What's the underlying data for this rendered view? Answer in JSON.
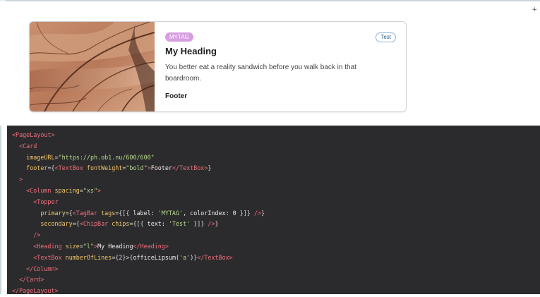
{
  "toolbar": {
    "expand_icon": "plus-icon"
  },
  "card": {
    "image": "photo of curved stone wall",
    "tag_label": "MYTAG",
    "chip_label": "Test",
    "heading": "My Heading",
    "body": "You better eat a reality sandwich before you walk back in that boardroom.",
    "footer": "Footer"
  },
  "colors": {
    "tag_bg": "#d79ee0",
    "chip_border": "#8fb2d6",
    "code_bg": "#2b2b2d",
    "code_tag": "#f06e7a",
    "code_attr": "#f3c667",
    "code_string": "#b9d98a"
  },
  "code": {
    "lines": [
      {
        "indent": "",
        "tokens": [
          {
            "c": "tg",
            "t": "<PageLayout>"
          }
        ]
      },
      {
        "indent": "  ",
        "tokens": [
          {
            "c": "tg",
            "t": "<Card"
          }
        ]
      },
      {
        "indent": "    ",
        "tokens": [
          {
            "c": "at",
            "t": "imageURL"
          },
          {
            "c": "pn",
            "t": "="
          },
          {
            "c": "st",
            "t": "\"https://ph.ob1.nu/600/600\""
          }
        ]
      },
      {
        "indent": "    ",
        "tokens": [
          {
            "c": "at",
            "t": "footer"
          },
          {
            "c": "pn",
            "t": "={"
          },
          {
            "c": "tg",
            "t": "<TextBox "
          },
          {
            "c": "at",
            "t": "fontWeight"
          },
          {
            "c": "pn",
            "t": "="
          },
          {
            "c": "st",
            "t": "\"bold\""
          },
          {
            "c": "tg",
            "t": ">"
          },
          {
            "c": "tx",
            "t": "Footer"
          },
          {
            "c": "tg",
            "t": "</TextBox>"
          },
          {
            "c": "pn",
            "t": "}"
          }
        ]
      },
      {
        "indent": "  ",
        "tokens": [
          {
            "c": "tg",
            "t": ">"
          }
        ]
      },
      {
        "indent": "    ",
        "tokens": [
          {
            "c": "tg",
            "t": "<Column "
          },
          {
            "c": "at",
            "t": "spacing"
          },
          {
            "c": "pn",
            "t": "="
          },
          {
            "c": "st",
            "t": "\"xs\""
          },
          {
            "c": "tg",
            "t": ">"
          }
        ]
      },
      {
        "indent": "      ",
        "tokens": [
          {
            "c": "tg",
            "t": "<Topper"
          }
        ]
      },
      {
        "indent": "        ",
        "tokens": [
          {
            "c": "at",
            "t": "primary"
          },
          {
            "c": "pn",
            "t": "={"
          },
          {
            "c": "tg",
            "t": "<TagBar "
          },
          {
            "c": "at",
            "t": "tags"
          },
          {
            "c": "pn",
            "t": "={[{ "
          },
          {
            "c": "tx",
            "t": "label: "
          },
          {
            "c": "st",
            "t": "'MYTAG'"
          },
          {
            "c": "tx",
            "t": ", colorIndex: 0 "
          },
          {
            "c": "pn",
            "t": "}]} "
          },
          {
            "c": "tg",
            "t": "/>"
          },
          {
            "c": "pn",
            "t": "}"
          }
        ]
      },
      {
        "indent": "        ",
        "tokens": [
          {
            "c": "at",
            "t": "secondary"
          },
          {
            "c": "pn",
            "t": "={"
          },
          {
            "c": "tg",
            "t": "<ChipBar "
          },
          {
            "c": "at",
            "t": "chips"
          },
          {
            "c": "pn",
            "t": "={[{ "
          },
          {
            "c": "tx",
            "t": "text: "
          },
          {
            "c": "st",
            "t": "'Test'"
          },
          {
            "c": "pn",
            "t": " }]} "
          },
          {
            "c": "tg",
            "t": "/>"
          },
          {
            "c": "pn",
            "t": "}"
          }
        ]
      },
      {
        "indent": "      ",
        "tokens": [
          {
            "c": "tg",
            "t": "/>"
          }
        ]
      },
      {
        "indent": "      ",
        "tokens": [
          {
            "c": "tg",
            "t": "<Heading "
          },
          {
            "c": "at",
            "t": "size"
          },
          {
            "c": "pn",
            "t": "="
          },
          {
            "c": "st",
            "t": "\"l\""
          },
          {
            "c": "tg",
            "t": ">"
          },
          {
            "c": "tx",
            "t": "My Heading"
          },
          {
            "c": "tg",
            "t": "</Heading>"
          }
        ]
      },
      {
        "indent": "      ",
        "tokens": [
          {
            "c": "tg",
            "t": "<TextBox "
          },
          {
            "c": "at",
            "t": "numberOfLines"
          },
          {
            "c": "pn",
            "t": "={2}>{"
          },
          {
            "c": "tx",
            "t": "officeLipsum("
          },
          {
            "c": "st",
            "t": "'a'"
          },
          {
            "c": "tx",
            "t": ")"
          },
          {
            "c": "pn",
            "t": "}"
          },
          {
            "c": "tg",
            "t": "</TextBox>"
          }
        ]
      },
      {
        "indent": "    ",
        "tokens": [
          {
            "c": "tg",
            "t": "</Column>"
          }
        ]
      },
      {
        "indent": "  ",
        "tokens": [
          {
            "c": "tg",
            "t": "</Card>"
          }
        ]
      },
      {
        "indent": "",
        "tokens": [
          {
            "c": "tg",
            "t": "</PageLayout>"
          }
        ]
      }
    ]
  }
}
